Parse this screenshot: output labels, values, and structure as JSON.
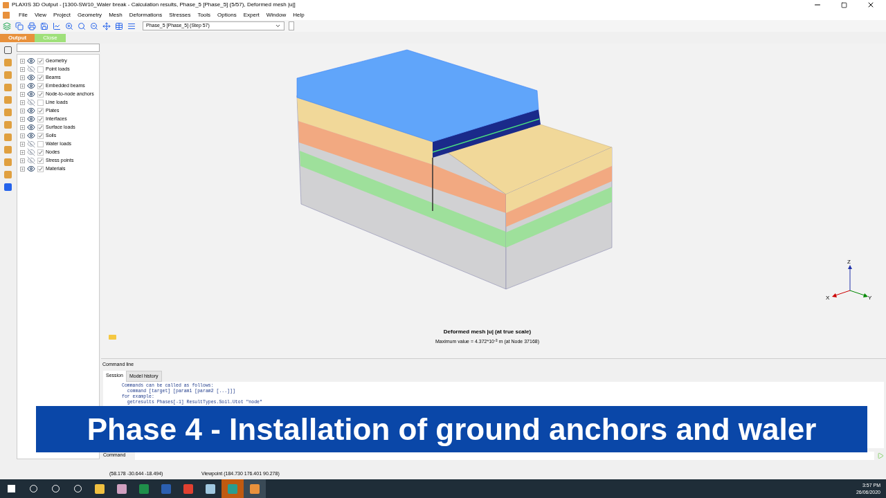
{
  "window": {
    "title": "PLAXIS 3D Output - [1300-SW10_Waler break - Calculation results, Phase_5 [Phase_5] (5/57), Deformed mesh |u|]"
  },
  "menu": [
    "File",
    "View",
    "Project",
    "Geometry",
    "Mesh",
    "Deformations",
    "Stresses",
    "Tools",
    "Options",
    "Expert",
    "Window",
    "Help"
  ],
  "phase_select": {
    "value": "Phase_5 [Phase_5] (Step 57)"
  },
  "mode_tabs": [
    {
      "label": "Output",
      "selected": true
    },
    {
      "label": "Close",
      "selected": false
    }
  ],
  "tree": [
    {
      "label": "Geometry",
      "visible": true,
      "checked": true
    },
    {
      "label": "Point loads",
      "visible": false,
      "checked": false
    },
    {
      "label": "Beams",
      "visible": true,
      "checked": true
    },
    {
      "label": "Embedded beams",
      "visible": true,
      "checked": true
    },
    {
      "label": "Node-to-node anchors",
      "visible": true,
      "checked": true
    },
    {
      "label": "Line loads",
      "visible": false,
      "checked": false
    },
    {
      "label": "Plates",
      "visible": true,
      "checked": true
    },
    {
      "label": "Interfaces",
      "visible": true,
      "checked": true
    },
    {
      "label": "Surface loads",
      "visible": true,
      "checked": true
    },
    {
      "label": "Soils",
      "visible": true,
      "checked": true
    },
    {
      "label": "Water loads",
      "visible": false,
      "checked": false
    },
    {
      "label": "Nodes",
      "visible": false,
      "checked": true
    },
    {
      "label": "Stress points",
      "visible": false,
      "checked": true
    },
    {
      "label": "Materials",
      "visible": true,
      "checked": true
    }
  ],
  "viewport": {
    "title": "Deformed mesh |u| (at true scale)",
    "subtitle": "Maximum value = 4.372*10$^{-3}$ m (at Node 37168)",
    "axes": [
      "Z",
      "X",
      "Y"
    ]
  },
  "command_panel": {
    "title": "Command line",
    "tabs": [
      {
        "label": "Session",
        "selected": true
      },
      {
        "label": "Model history",
        "selected": false
      }
    ],
    "lines": [
      "Commands can be called as follows:",
      "  command [target] [param1 [param2 [...]]]",
      "for example:",
      "  getresults Phases[-1] ResultTypes.Soil.Utot \"node\""
    ],
    "command_label": "Command"
  },
  "status_bar": [
    "(58.178 -30.644 -18.494)",
    "Viewpoint (184.730 176.401 90.278)"
  ],
  "banner": "Phase 4 - Installation of ground anchors and waler",
  "taskbar": {
    "time": "3:57 PM",
    "date": "26/06/2020"
  }
}
